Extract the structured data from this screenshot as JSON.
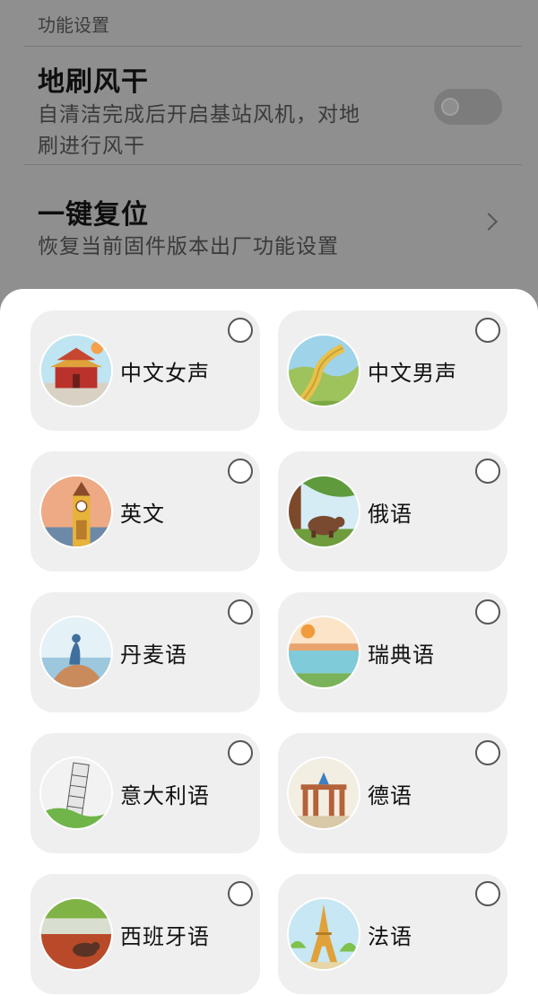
{
  "settings": {
    "section_title": "功能设置",
    "dry": {
      "title": "地刷风干",
      "desc_line1": "自清洁完成后开启基站风机，对地",
      "desc_line2": "刷进行风干"
    },
    "reset": {
      "title": "一键复位",
      "desc": "恢复当前固件版本出厂功能设置"
    }
  },
  "voices": [
    {
      "label": "中文女声",
      "icon": "china-palace-icon"
    },
    {
      "label": "中文男声",
      "icon": "great-wall-icon"
    },
    {
      "label": "英文",
      "icon": "big-ben-icon"
    },
    {
      "label": "俄语",
      "icon": "bear-icon"
    },
    {
      "label": "丹麦语",
      "icon": "little-mermaid-icon"
    },
    {
      "label": "瑞典语",
      "icon": "stockholm-icon"
    },
    {
      "label": "意大利语",
      "icon": "leaning-tower-icon"
    },
    {
      "label": "德语",
      "icon": "brandenburg-gate-icon"
    },
    {
      "label": "西班牙语",
      "icon": "bull-ring-icon"
    },
    {
      "label": "法语",
      "icon": "eiffel-tower-icon"
    }
  ],
  "colors": {
    "overlay": "#8f8f8f",
    "sheet": "#ffffff",
    "card": "#efefef"
  }
}
